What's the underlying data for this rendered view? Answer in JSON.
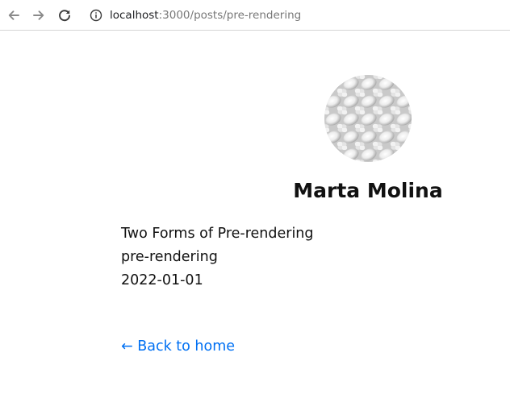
{
  "browser": {
    "url_host": "localhost",
    "url_rest": ":3000/posts/pre-rendering",
    "icons": {
      "back": "arrow-left-icon",
      "forward": "arrow-right-icon",
      "reload": "reload-icon",
      "site_info": "info-icon"
    }
  },
  "profile": {
    "name": "Marta Molina",
    "avatar": "woven-texture-avatar"
  },
  "post": {
    "title": "Two Forms of Pre-rendering",
    "id": "pre-rendering",
    "date": "2022-01-01"
  },
  "footer": {
    "back_link": "← Back to home",
    "link_color": "#0070f3"
  }
}
